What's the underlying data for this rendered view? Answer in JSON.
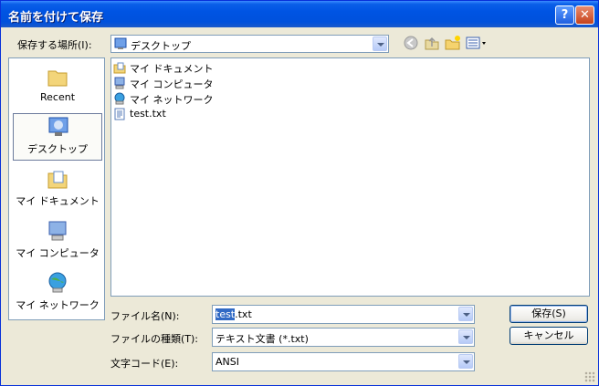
{
  "window": {
    "title": "名前を付けて保存"
  },
  "titlebar": {
    "help_label": "?",
    "close_label": "✕"
  },
  "location": {
    "label": "保存する場所(I):",
    "value": "デスクトップ"
  },
  "places": [
    {
      "label": "Recent",
      "icon": "recent-folder-icon"
    },
    {
      "label": "デスクトップ",
      "icon": "desktop-icon"
    },
    {
      "label": "マイ ドキュメント",
      "icon": "my-documents-icon"
    },
    {
      "label": "マイ コンピュータ",
      "icon": "my-computer-icon"
    },
    {
      "label": "マイ ネットワーク",
      "icon": "my-network-icon"
    }
  ],
  "files": [
    {
      "name": "マイ ドキュメント",
      "icon": "my-documents-icon"
    },
    {
      "name": "マイ コンピュータ",
      "icon": "my-computer-icon"
    },
    {
      "name": "マイ ネットワーク",
      "icon": "my-network-icon"
    },
    {
      "name": "test.txt",
      "icon": "text-file-icon"
    }
  ],
  "form": {
    "filename_label": "ファイル名(N):",
    "filename_selected": "test",
    "filename_rest": ".txt",
    "filetype_label": "ファイルの種類(T):",
    "filetype_value": "テキスト文書 (*.txt)",
    "encoding_label": "文字コード(E):",
    "encoding_value": "ANSI"
  },
  "buttons": {
    "save": "保存(S)",
    "cancel": "キャンセル"
  },
  "colors": {
    "titlebar": "#0054e3",
    "dialog_bg": "#ece9d8",
    "selection": "#316ac5"
  }
}
